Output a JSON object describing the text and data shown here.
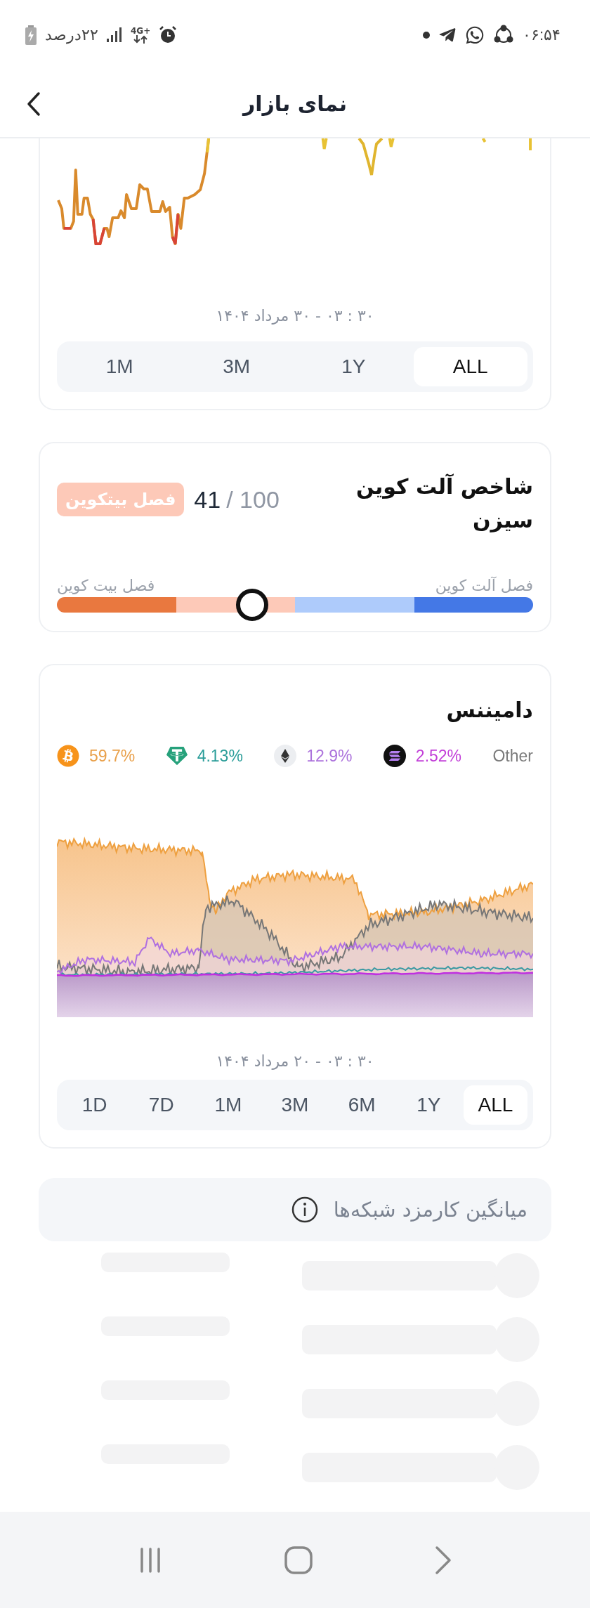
{
  "status_bar": {
    "time": "۰۶:۵۴",
    "battery": "۲۲درصد",
    "network": "4G+"
  },
  "header": {
    "title": "نمای بازار"
  },
  "price_card": {
    "date": "۳۰ : ۰۳ - ۳۰ مرداد ۱۴۰۴",
    "ranges": [
      {
        "label": "ALL",
        "selected": true
      },
      {
        "label": "1Y",
        "selected": false
      },
      {
        "label": "3M",
        "selected": false
      },
      {
        "label": "1M",
        "selected": false
      }
    ]
  },
  "altcoin_season": {
    "title": "شاخص آلت کوین سیزن",
    "score": "41",
    "max": "/ 100",
    "badge": "فصل بیتکوین",
    "level": 0.41,
    "left_label": "فصل بیت کوین",
    "right_label": "فصل آلت کوین"
  },
  "dominance": {
    "title": "دامیننس",
    "legend": [
      {
        "kind": "other",
        "value": "Other",
        "color": "#7b7b7b"
      },
      {
        "kind": "sol",
        "value": "2.52%",
        "color": "#c23fd8"
      },
      {
        "kind": "eth",
        "value": "12.9%",
        "color": "#ac72dc"
      },
      {
        "kind": "usdt",
        "value": "4.13%",
        "color": "#2a9d99"
      },
      {
        "kind": "btc",
        "value": "59.7%",
        "color": "#e9a04a"
      }
    ],
    "date": "۳۰ : ۰۳ - ۲۰ مرداد ۱۴۰۴",
    "ranges": [
      {
        "label": "ALL",
        "selected": true
      },
      {
        "label": "1Y",
        "selected": false
      },
      {
        "label": "6M",
        "selected": false
      },
      {
        "label": "3M",
        "selected": false
      },
      {
        "label": "1M",
        "selected": false
      },
      {
        "label": "7D",
        "selected": false
      },
      {
        "label": "1D",
        "selected": false
      }
    ]
  },
  "fees": {
    "title": "میانگین کارمزد شبکه‌ها",
    "rows": [
      {
        "kind": "loading"
      },
      {
        "kind": "loading"
      },
      {
        "kind": "loading"
      },
      {
        "kind": "loading"
      }
    ]
  }
}
